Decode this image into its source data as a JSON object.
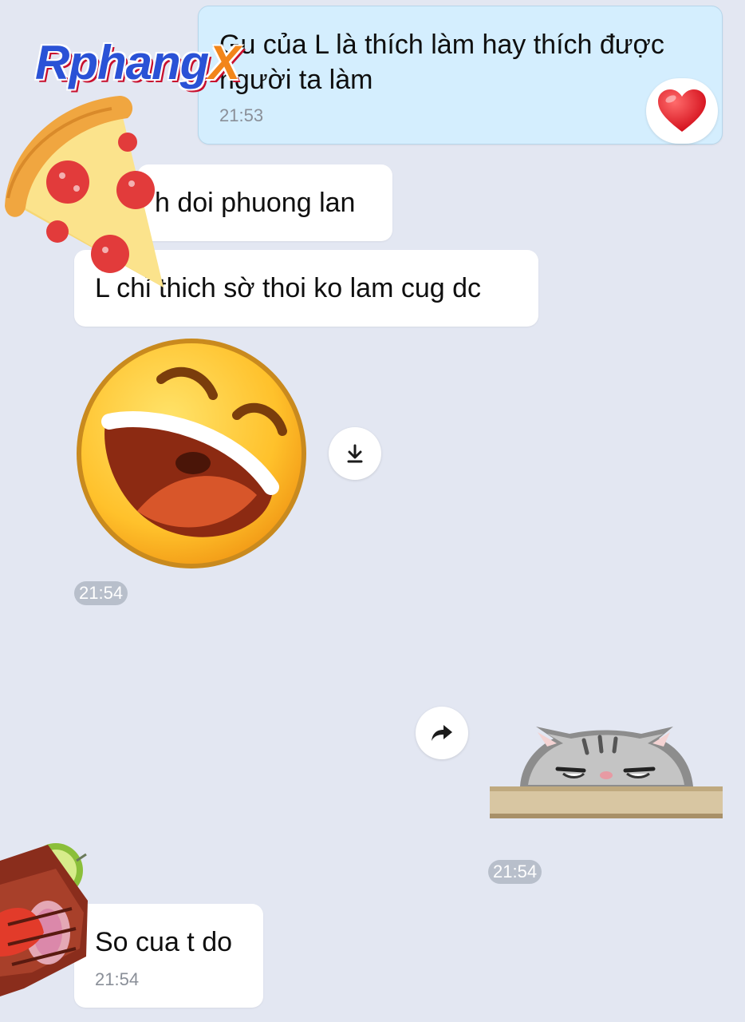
{
  "watermark": {
    "main": "Rphang",
    "x": "X"
  },
  "messages": [
    {
      "text": "Gu của L là thích làm hay thích được người ta làm",
      "time": "21:53",
      "reaction": "heart-icon"
    },
    {
      "text": "h doi phuong lan"
    },
    {
      "text": "L chỉ thich sờ thoi ko lam cug dc"
    },
    {
      "time": "21:54"
    },
    {
      "time": "21:54"
    },
    {
      "text": "So cua t do",
      "time": "21:54"
    }
  ],
  "stickers": {
    "laughing": "laughing-face-sticker",
    "cat": "peeking-cat-sticker",
    "pizza": "pizza-slice",
    "meat": "grilled-meat"
  },
  "colors": {
    "background": "#e3e7f2",
    "outgoing_bubble": "#d4eefe",
    "incoming_bubble": "#ffffff",
    "time_pill": "#b8bfcb"
  }
}
